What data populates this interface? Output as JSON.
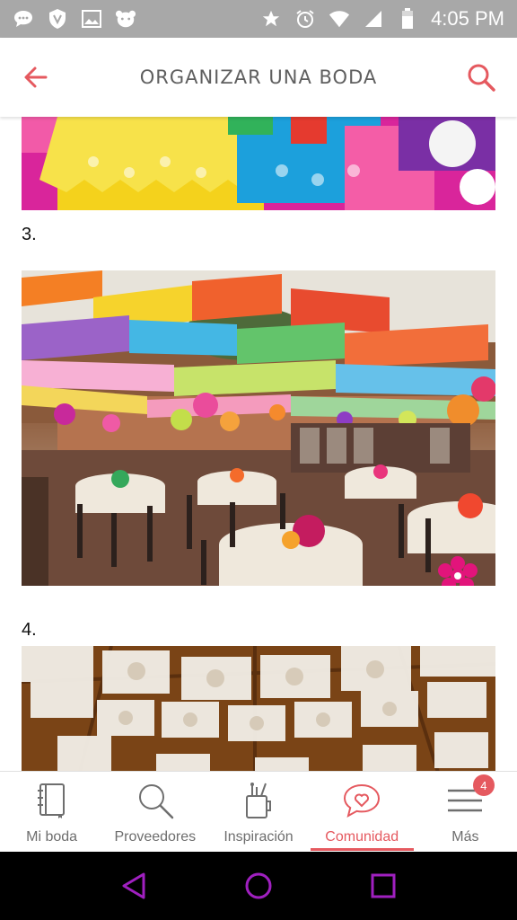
{
  "status_bar": {
    "time": "4:05 PM"
  },
  "app_bar": {
    "title": "ORGANIZAR UNA BODA"
  },
  "content": {
    "items": [
      {
        "number": "3."
      },
      {
        "number": "4."
      }
    ]
  },
  "bottom_nav": {
    "items": [
      {
        "label": "Mi boda",
        "icon": "notebook-icon"
      },
      {
        "label": "Proveedores",
        "icon": "search-icon"
      },
      {
        "label": "Inspiración",
        "icon": "pencil-cup-icon"
      },
      {
        "label": "Comunidad",
        "icon": "chat-heart-icon",
        "active": true
      },
      {
        "label": "Más",
        "icon": "menu-icon",
        "badge": "4"
      }
    ]
  },
  "colors": {
    "accent": "#e5595f",
    "status_bar": "#a8a8a8",
    "system_nav_icons": "#a020c0"
  }
}
